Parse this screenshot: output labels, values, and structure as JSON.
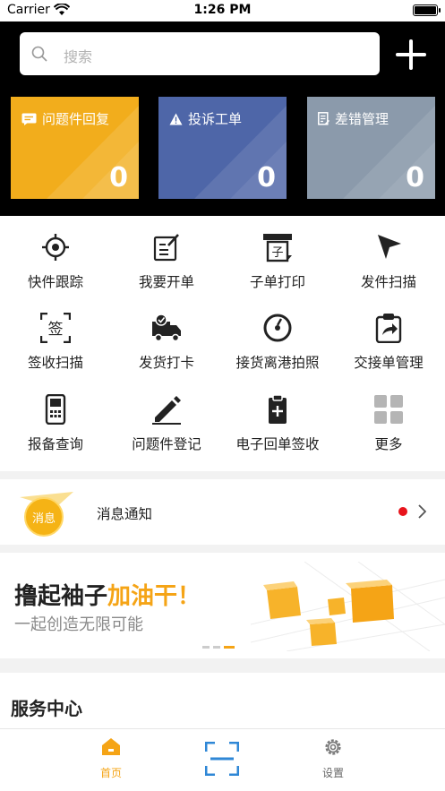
{
  "status_bar": {
    "carrier": "Carrier",
    "time": "1:26 PM"
  },
  "search": {
    "placeholder": "搜索"
  },
  "stats": [
    {
      "title": "问题件回复",
      "count": "0",
      "icon": "message-icon",
      "color": "#f2ad1c"
    },
    {
      "title": "投诉工单",
      "count": "0",
      "icon": "warning-icon",
      "color": "#4e66a8"
    },
    {
      "title": "差错管理",
      "count": "0",
      "icon": "document-icon",
      "color": "#8b9aab"
    }
  ],
  "grid": [
    {
      "label": "快件跟踪",
      "icon": "target-icon"
    },
    {
      "label": "我要开单",
      "icon": "edit-form-icon"
    },
    {
      "label": "子单打印",
      "icon": "printer-icon"
    },
    {
      "label": "发件扫描",
      "icon": "send-arrow-icon"
    },
    {
      "label": "签收扫描",
      "icon": "sign-scan-icon"
    },
    {
      "label": "发货打卡",
      "icon": "truck-icon"
    },
    {
      "label": "接货离港拍照",
      "icon": "camera-lens-icon"
    },
    {
      "label": "交接单管理",
      "icon": "clipboard-share-icon"
    },
    {
      "label": "报备查询",
      "icon": "phone-device-icon"
    },
    {
      "label": "问题件登记",
      "icon": "pen-icon"
    },
    {
      "label": "电子回单签收",
      "icon": "clipboard-plus-icon"
    },
    {
      "label": "更多",
      "icon": "grid-more-icon"
    }
  ],
  "notice": {
    "badge": "消息",
    "title": "消息通知"
  },
  "banner": {
    "headline_main": "撸起袖子",
    "headline_accent": "加油干！",
    "subline": "一起创造无限可能",
    "slides": 3,
    "active_slide": 3
  },
  "service": {
    "title": "服务中心"
  },
  "tabbar": {
    "home": "首页",
    "settings": "设置"
  },
  "colors": {
    "accent": "#f5a416",
    "header_bg": "#000000"
  }
}
